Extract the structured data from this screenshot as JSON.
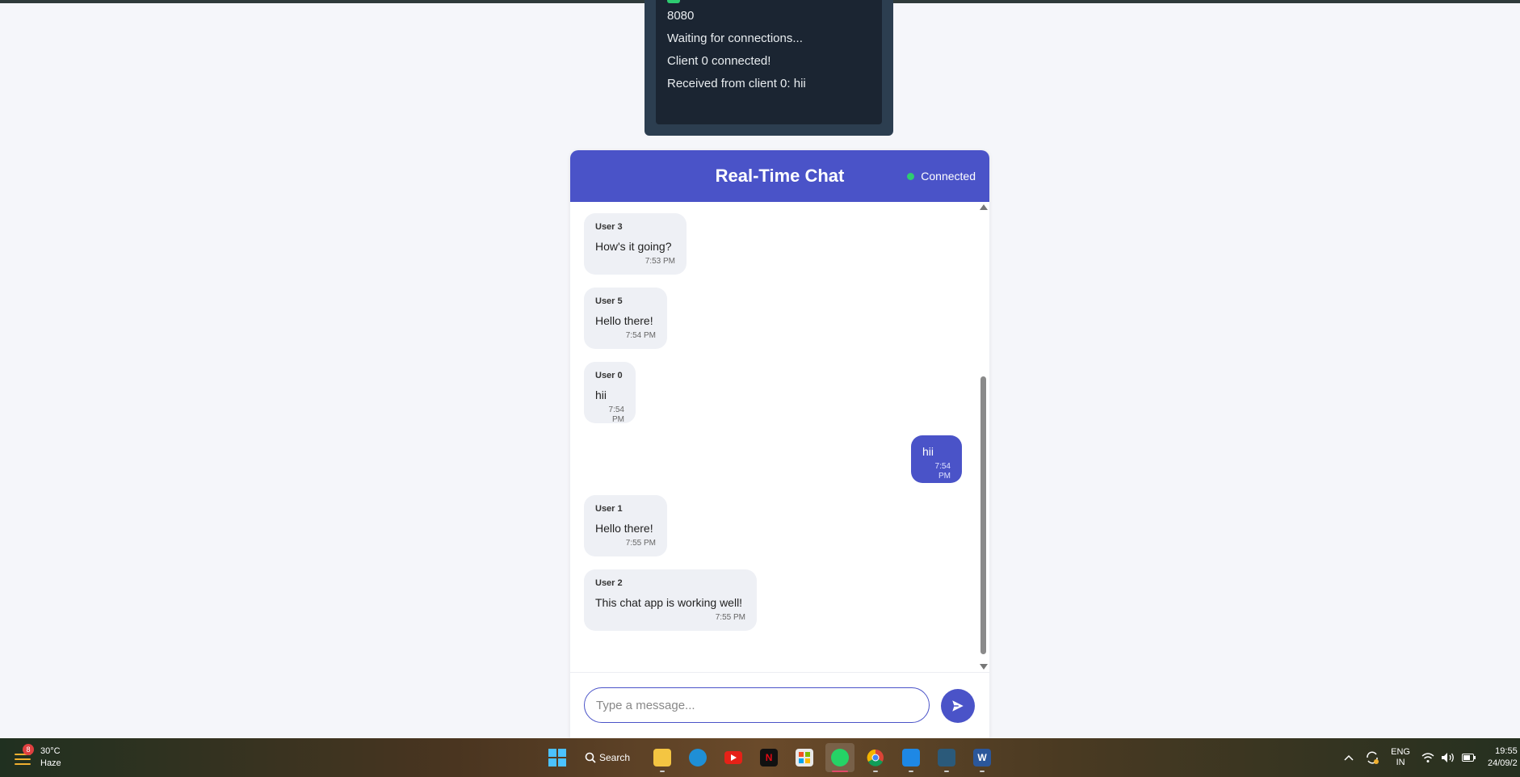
{
  "console": {
    "lines": [
      "8080",
      "Waiting for connections...",
      "Client 0 connected!",
      "Received from client 0: hii"
    ]
  },
  "chat": {
    "title": "Real-Time Chat",
    "status": "Connected",
    "messages": [
      {
        "sender": "User 3",
        "text": "How's it going?",
        "time": "7:53 PM"
      },
      {
        "sender": "User 5",
        "text": "Hello there!",
        "time": "7:54 PM"
      },
      {
        "sender": "User 0",
        "text": "hii",
        "time": "7:54 PM"
      },
      {
        "sender": "",
        "text": "hii",
        "time": "7:54 PM",
        "self": true
      },
      {
        "sender": "User 1",
        "text": "Hello there!",
        "time": "7:55 PM"
      },
      {
        "sender": "User 2",
        "text": "This chat app is working well!",
        "time": "7:55 PM"
      }
    ],
    "input": {
      "placeholder": "Type a message...",
      "value": ""
    },
    "colors": {
      "accent": "#4a53c8",
      "status": "#2ecc71",
      "bubble": "#eef0f5"
    }
  },
  "taskbar": {
    "weather": {
      "temp": "30°C",
      "condition": "Haze",
      "badge": "8"
    },
    "search_label": "Search",
    "apps": [
      "file-explorer-icon",
      "edge-icon",
      "youtube-icon",
      "netflix-icon",
      "ms-store-icon",
      "whatsapp-icon",
      "chrome-icon",
      "vscode-icon",
      "mysql-workbench-icon",
      "word-icon"
    ],
    "language": {
      "lang": "ENG",
      "region": "IN"
    },
    "clock": {
      "time": "19:55",
      "date": "24/09/2"
    }
  }
}
